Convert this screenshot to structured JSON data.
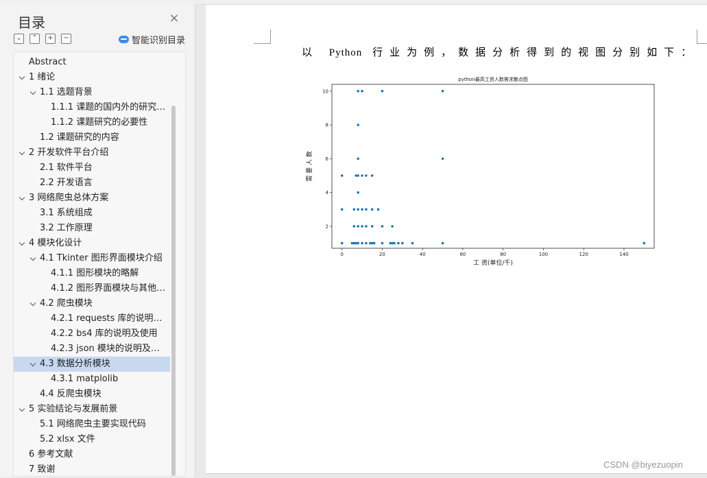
{
  "sidebar": {
    "title": "目录",
    "smart_label": "智能识别目录",
    "tools": [
      "expand-all",
      "collapse-all",
      "add",
      "remove"
    ],
    "items": [
      {
        "label": "Abstract",
        "level": 0,
        "chevron": false,
        "selected": false
      },
      {
        "label": "1  绪论",
        "level": 0,
        "chevron": true,
        "selected": false
      },
      {
        "label": "1.1 选题背景",
        "level": 1,
        "chevron": true,
        "selected": false
      },
      {
        "label": "1.1.1 课题的国内外的研究现状",
        "level": 2,
        "chevron": false,
        "selected": false
      },
      {
        "label": "1.1.2 课题研究的必要性",
        "level": 2,
        "chevron": false,
        "selected": false
      },
      {
        "label": "1.2 课题研究的内容",
        "level": 1,
        "chevron": false,
        "selected": false
      },
      {
        "label": "2 开发软件平台介绍",
        "level": 0,
        "chevron": true,
        "selected": false
      },
      {
        "label": "2.1   软件平台",
        "level": 1,
        "chevron": false,
        "selected": false
      },
      {
        "label": "2.2   开发语言",
        "level": 1,
        "chevron": false,
        "selected": false
      },
      {
        "label": "3 网络爬虫总体方案",
        "level": 0,
        "chevron": true,
        "selected": false
      },
      {
        "label": "3.1  系统组成",
        "level": 1,
        "chevron": false,
        "selected": false
      },
      {
        "label": "3.2  工作原理",
        "level": 1,
        "chevron": false,
        "selected": false
      },
      {
        "label": "4 模块化设计",
        "level": 0,
        "chevron": true,
        "selected": false
      },
      {
        "label": "4.1  Tkinter 图形界面模块介绍",
        "level": 1,
        "chevron": true,
        "selected": false
      },
      {
        "label": "4.1.1 图形模块的略解",
        "level": 2,
        "chevron": false,
        "selected": false
      },
      {
        "label": "4.1.2 图形界面模块与其他模块的连接",
        "level": 2,
        "chevron": false,
        "selected": false
      },
      {
        "label": "4.2  爬虫模块",
        "level": 1,
        "chevron": true,
        "selected": false
      },
      {
        "label": "4.2.1 requests 库的说明及使用",
        "level": 2,
        "chevron": false,
        "selected": false
      },
      {
        "label": "4.2.2 bs4 库的说明及使用",
        "level": 2,
        "chevron": false,
        "selected": false
      },
      {
        "label": "4.2.3 json 模块的说明及使用",
        "level": 2,
        "chevron": false,
        "selected": false
      },
      {
        "label": "4.3   数据分析模块",
        "level": 1,
        "chevron": true,
        "selected": true
      },
      {
        "label": "4.3.1 matplolib",
        "level": 2,
        "chevron": false,
        "selected": false
      },
      {
        "label": "4.4   反爬虫模块",
        "level": 1,
        "chevron": false,
        "selected": false
      },
      {
        "label": "5 实验结论与发展前景",
        "level": 0,
        "chevron": true,
        "selected": false
      },
      {
        "label": "5.1 网络爬虫主要实现代码",
        "level": 1,
        "chevron": false,
        "selected": false
      },
      {
        "label": "5.2 xlsx 文件",
        "level": 1,
        "chevron": false,
        "selected": false
      },
      {
        "label": "6 参考文献",
        "level": 0,
        "chevron": false,
        "selected": false
      },
      {
        "label": "7 致谢",
        "level": 0,
        "chevron": false,
        "selected": false
      }
    ]
  },
  "document": {
    "text_parts": [
      "以",
      "Python",
      "行业为例，数据分析得到的视图分别如下："
    ]
  },
  "watermark": "CSDN @biyezuopin",
  "chart_data": {
    "type": "scatter",
    "title": "python最高工资人数需求散点图",
    "xlabel": "工 资(单位/千)",
    "ylabel": "需 要 人 数",
    "xlim": [
      -5,
      155
    ],
    "ylim": [
      0.7,
      10.4
    ],
    "xticks": [
      0,
      20,
      40,
      60,
      80,
      100,
      120,
      140
    ],
    "yticks": [
      2,
      4,
      6,
      8,
      10
    ],
    "color": "#1f77b4",
    "points": [
      [
        8,
        10
      ],
      [
        10,
        10
      ],
      [
        20,
        10
      ],
      [
        50,
        10
      ],
      [
        8,
        8
      ],
      [
        8,
        6
      ],
      [
        50,
        6
      ],
      [
        0,
        5
      ],
      [
        7,
        5
      ],
      [
        8,
        5
      ],
      [
        10,
        5
      ],
      [
        12,
        5
      ],
      [
        15,
        5
      ],
      [
        8,
        4
      ],
      [
        0,
        3
      ],
      [
        6,
        3
      ],
      [
        8,
        3
      ],
      [
        10,
        3
      ],
      [
        12,
        3
      ],
      [
        15,
        3
      ],
      [
        18,
        3
      ],
      [
        6,
        2
      ],
      [
        8,
        2
      ],
      [
        10,
        2
      ],
      [
        12,
        2
      ],
      [
        15,
        2
      ],
      [
        20,
        2
      ],
      [
        25,
        2
      ],
      [
        0,
        1
      ],
      [
        5,
        1
      ],
      [
        6,
        1
      ],
      [
        7,
        1
      ],
      [
        8,
        1
      ],
      [
        10,
        1
      ],
      [
        12,
        1
      ],
      [
        14,
        1
      ],
      [
        15,
        1
      ],
      [
        16,
        1
      ],
      [
        20,
        1
      ],
      [
        24,
        1
      ],
      [
        25,
        1
      ],
      [
        26,
        1
      ],
      [
        28,
        1
      ],
      [
        30,
        1
      ],
      [
        35,
        1
      ],
      [
        50,
        1
      ],
      [
        150,
        1
      ]
    ]
  }
}
